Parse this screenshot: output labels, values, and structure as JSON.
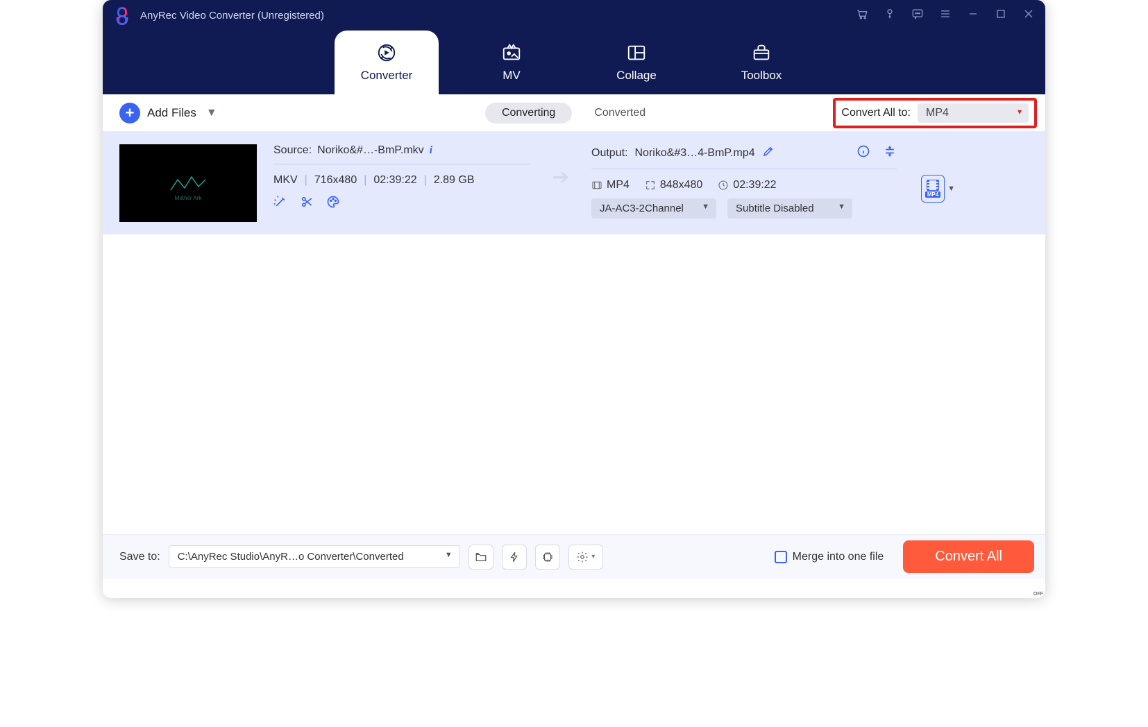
{
  "app": {
    "title": "AnyRec Video Converter (Unregistered)"
  },
  "nav": {
    "tabs": [
      {
        "label": "Converter"
      },
      {
        "label": "MV"
      },
      {
        "label": "Collage"
      },
      {
        "label": "Toolbox"
      }
    ]
  },
  "toolbar": {
    "add_files_label": "Add Files",
    "status_tabs": {
      "converting": "Converting",
      "converted": "Converted"
    },
    "convert_all_label": "Convert All to:",
    "convert_all_format": "MP4"
  },
  "file": {
    "source_prefix": "Source:",
    "source_name": "Noriko&#…-BmP.mkv",
    "meta": {
      "container": "MKV",
      "resolution": "716x480",
      "duration": "02:39:22",
      "size": "2.89 GB"
    },
    "output_prefix": "Output:",
    "output_name": "Noriko&#3…4-BmP.mp4",
    "out_meta": {
      "container": "MP4",
      "resolution": "848x480",
      "duration": "02:39:22"
    },
    "audio_track": "JA-AC3-2Channel",
    "subtitle": "Subtitle Disabled",
    "format_badge": "MP4",
    "thumb_text": "Mother Ark"
  },
  "footer": {
    "save_to_label": "Save to:",
    "save_path": "C:\\AnyRec Studio\\AnyR…o Converter\\Converted",
    "merge_label": "Merge into one file",
    "convert_button": "Convert All"
  }
}
